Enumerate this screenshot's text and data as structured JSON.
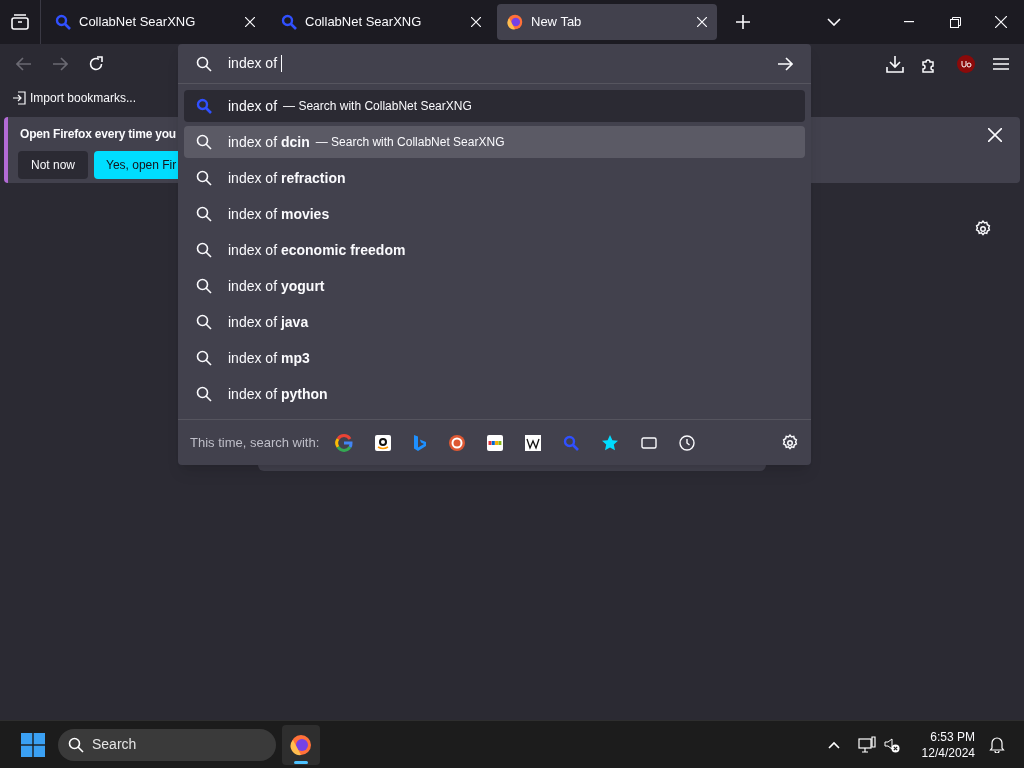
{
  "tabs": [
    {
      "title": "CollabNet SearXNG",
      "kind": "searxng",
      "selected": false
    },
    {
      "title": "CollabNet SearXNG",
      "kind": "searxng",
      "selected": false
    },
    {
      "title": "New Tab",
      "kind": "firefox",
      "selected": true
    }
  ],
  "bookmarks": [
    {
      "label": "Import bookmarks..."
    }
  ],
  "notification": {
    "message": "Open Firefox every time you",
    "buttons": [
      {
        "label": "Not now",
        "kind": "secondary"
      },
      {
        "label": "Yes, open Fir",
        "kind": "primary"
      }
    ]
  },
  "address_bar": {
    "value": "index of "
  },
  "suggestions": [
    {
      "text": "index of",
      "action": "— Search with CollabNet SearXNG",
      "kind": "searxng",
      "selected": true,
      "hovered": false
    },
    {
      "text": "index of **dcin**",
      "action": "— Search with CollabNet SearXNG",
      "kind": "search",
      "selected": false,
      "hovered": true
    },
    {
      "text": "index of **refraction**",
      "kind": "search",
      "selected": false,
      "hovered": false
    },
    {
      "text": "index of **movies**",
      "kind": "search",
      "selected": false,
      "hovered": false
    },
    {
      "text": "index of **economic freedom**",
      "kind": "search",
      "selected": false,
      "hovered": false
    },
    {
      "text": "index of **yogurt**",
      "kind": "search",
      "selected": false,
      "hovered": false
    },
    {
      "text": "index of **java**",
      "kind": "search",
      "selected": false,
      "hovered": false
    },
    {
      "text": "index of **mp3**",
      "kind": "search",
      "selected": false,
      "hovered": false
    },
    {
      "text": "index of **python**",
      "kind": "search",
      "selected": false,
      "hovered": false
    }
  ],
  "search_with": {
    "label": "This time, search with:",
    "engines": [
      {
        "kind": "google"
      },
      {
        "kind": "amazon"
      },
      {
        "kind": "bing"
      },
      {
        "kind": "duckduckgo"
      },
      {
        "kind": "ebay"
      },
      {
        "kind": "wikipedia"
      },
      {
        "kind": "searxng"
      },
      {
        "kind": "bookmarks"
      },
      {
        "kind": "tabs"
      },
      {
        "kind": "history"
      }
    ]
  },
  "taskbar": {
    "search_placeholder": "Search",
    "time": "6:53 PM",
    "date": "12/4/2024"
  }
}
